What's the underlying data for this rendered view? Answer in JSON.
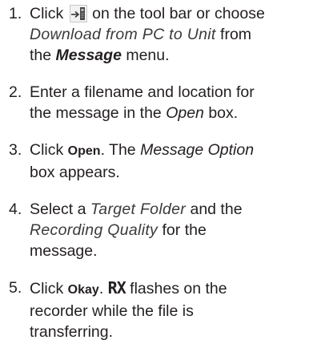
{
  "steps": [
    {
      "number": "1.",
      "line1_pre": "Click",
      "icon": "download-to-unit-icon",
      "line1_post": "on the tool bar or choose",
      "line2_italic": "Download from PC to Unit",
      "line2_post": "from",
      "line3_pre": "the",
      "line3_menu": "Message",
      "line3_post": "menu."
    },
    {
      "number": "2.",
      "line1": "Enter a filename and location for",
      "line2_pre": "the message in the",
      "line2_italic": "Open",
      "line2_post": "box."
    },
    {
      "number": "3.",
      "line1_pre": "Click",
      "line1_bold": "Open",
      "line1_mid": ". The",
      "line1_italic": "Message Option",
      "line2": "box appears."
    },
    {
      "number": "4.",
      "line1_pre": "Select a",
      "line1_italic": "Target Folder",
      "line1_post": "and the",
      "line2_italic": "Recording Quality",
      "line2_post": "for the",
      "line3": "message."
    },
    {
      "number": "5.",
      "line1_pre": "Click",
      "line1_bold": "Okay",
      "line1_mid": ".",
      "line1_symbol": "RX",
      "line1_post": "flashes on the",
      "line2": "recorder while the file is",
      "line3": "transferring."
    }
  ]
}
